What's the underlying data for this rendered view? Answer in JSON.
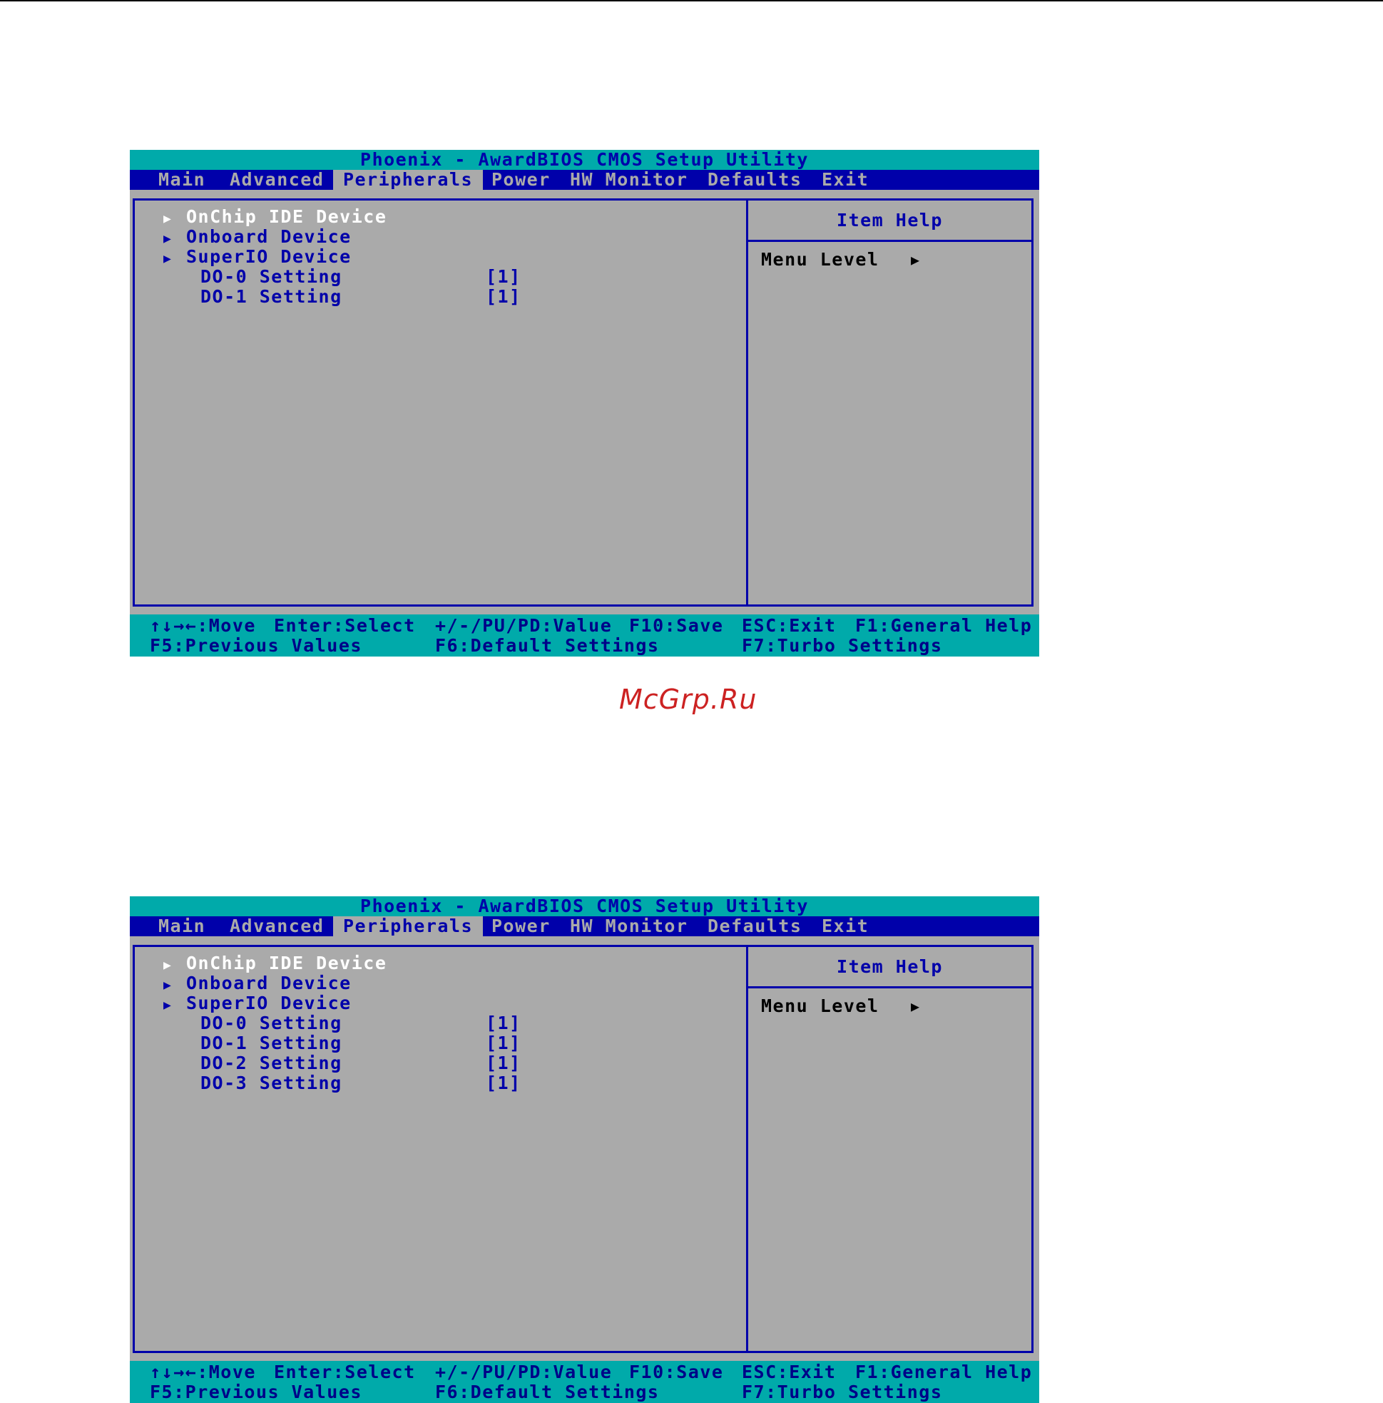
{
  "watermark": "McGrp.Ru",
  "screens": [
    {
      "title": "Phoenix - AwardBIOS CMOS Setup Utility",
      "menu": [
        "Main",
        "Advanced",
        "Peripherals",
        "Power",
        "HW Monitor",
        "Defaults",
        "Exit"
      ],
      "active_menu": "Peripherals",
      "submenus": [
        "OnChip IDE Device",
        "Onboard Device",
        "SuperIO Device"
      ],
      "settings": [
        {
          "label": "DO-0 Setting",
          "value": "[1]"
        },
        {
          "label": "DO-1 Setting",
          "value": "[1]"
        }
      ],
      "help": {
        "title": "Item Help",
        "menu_level": "Menu Level",
        "arrow": "▶"
      },
      "footer": {
        "move": "↑↓→←:Move",
        "select": "Enter:Select",
        "value": "+/-/PU/PD:Value",
        "save": "F10:Save",
        "exit": "ESC:Exit",
        "help": "F1:General Help",
        "previous": "F5:Previous Values",
        "defaults": "F6:Default Settings",
        "turbo": "F7:Turbo Settings"
      }
    },
    {
      "title": "Phoenix - AwardBIOS CMOS Setup Utility",
      "menu": [
        "Main",
        "Advanced",
        "Peripherals",
        "Power",
        "HW Monitor",
        "Defaults",
        "Exit"
      ],
      "active_menu": "Peripherals",
      "submenus": [
        "OnChip IDE Device",
        "Onboard Device",
        "SuperIO Device"
      ],
      "settings": [
        {
          "label": "DO-0 Setting",
          "value": "[1]"
        },
        {
          "label": "DO-1 Setting",
          "value": "[1]"
        },
        {
          "label": "DO-2 Setting",
          "value": "[1]"
        },
        {
          "label": "DO-3 Setting",
          "value": "[1]"
        }
      ],
      "help": {
        "title": "Item Help",
        "menu_level": "Menu Level",
        "arrow": "▶"
      },
      "footer": {
        "move": "↑↓→←:Move",
        "select": "Enter:Select",
        "value": "+/-/PU/PD:Value",
        "save": "F10:Save",
        "exit": "ESC:Exit",
        "help": "F1:General Help",
        "previous": "F5:Previous Values",
        "defaults": "F6:Default Settings",
        "turbo": "F7:Turbo Settings"
      }
    }
  ]
}
